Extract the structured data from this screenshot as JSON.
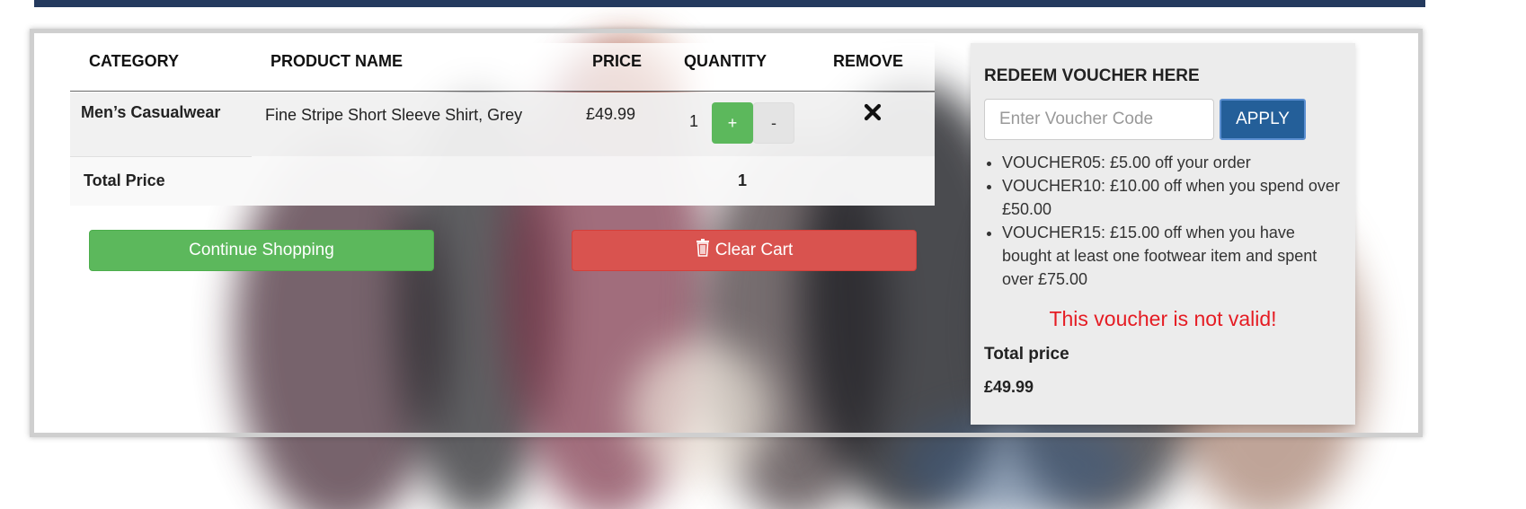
{
  "cart": {
    "headers": {
      "category": "CATEGORY",
      "product_name": "PRODUCT NAME",
      "price": "PRICE",
      "quantity": "QUANTITY",
      "remove": "REMOVE"
    },
    "items": [
      {
        "category": "Men’s Casualwear",
        "product_name": "Fine Stripe Short Sleeve Shirt, Grey",
        "price": "£49.99",
        "quantity": "1",
        "plus_label": "+",
        "minus_label": "-",
        "remove_icon": "close-icon"
      }
    ],
    "total_label": "Total Price",
    "total_quantity": "1"
  },
  "actions": {
    "continue_label": "Continue Shopping",
    "clear_label": "Clear Cart",
    "clear_icon": "trash-icon"
  },
  "voucher": {
    "title": "REDEEM VOUCHER HERE",
    "input_placeholder": "Enter Voucher Code",
    "input_value": "",
    "apply_label": "APPLY",
    "offers": [
      "VOUCHER05: £5.00 off your order",
      "VOUCHER10: £10.00 off when you spend over £50.00",
      "VOUCHER15: £15.00 off when you have bought at least one footwear item and spent over £75.00"
    ],
    "error_message": "This voucher is not valid!",
    "total_label": "Total price",
    "total_value": "£49.99"
  },
  "colors": {
    "header_bar": "#243a5e",
    "success": "#5cb85c",
    "danger": "#d9534f",
    "primary": "#245f99",
    "error_text": "#e51c23"
  }
}
